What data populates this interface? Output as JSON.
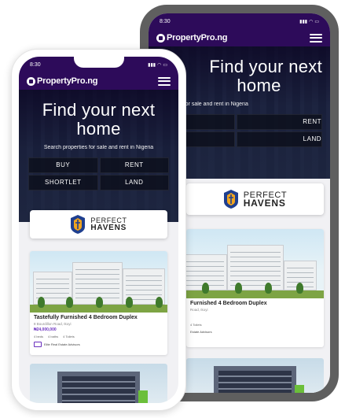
{
  "status": {
    "time": "8:30"
  },
  "nav": {
    "logo_text": "PropertyPro.ng"
  },
  "hero": {
    "title_line1": "Find your next",
    "title_line2": "home",
    "subtitle": "Search properties for sale and rent in Nigeria",
    "subtitle_back": "rch properties for sale and rent in Nigeria"
  },
  "buttons": {
    "buy": "BUY",
    "rent": "RENT",
    "shortlet": "SHORTLET",
    "shortlet_back": "ORTLET",
    "land": "LAND"
  },
  "partner": {
    "line1": "PERFECT",
    "line2": "HAVENS"
  },
  "listing": {
    "title": "Tastefully Furnished 4 Bedroom Duplex",
    "title_back": "Furnished 4 Bedroom Duplex",
    "address": "8 Bourdillon Road, Ikoyi",
    "address_back": "Road, Ikoyi",
    "price": "₦24,000,000",
    "beds": "4 beds",
    "baths": "4 baths",
    "toilets": "4 Toilets",
    "agent": "Elite Real Estate Advisors",
    "agent_back": "Estate Advisors"
  },
  "colors": {
    "brand": "#2d0b5a",
    "accent": "#6a2fbf"
  }
}
